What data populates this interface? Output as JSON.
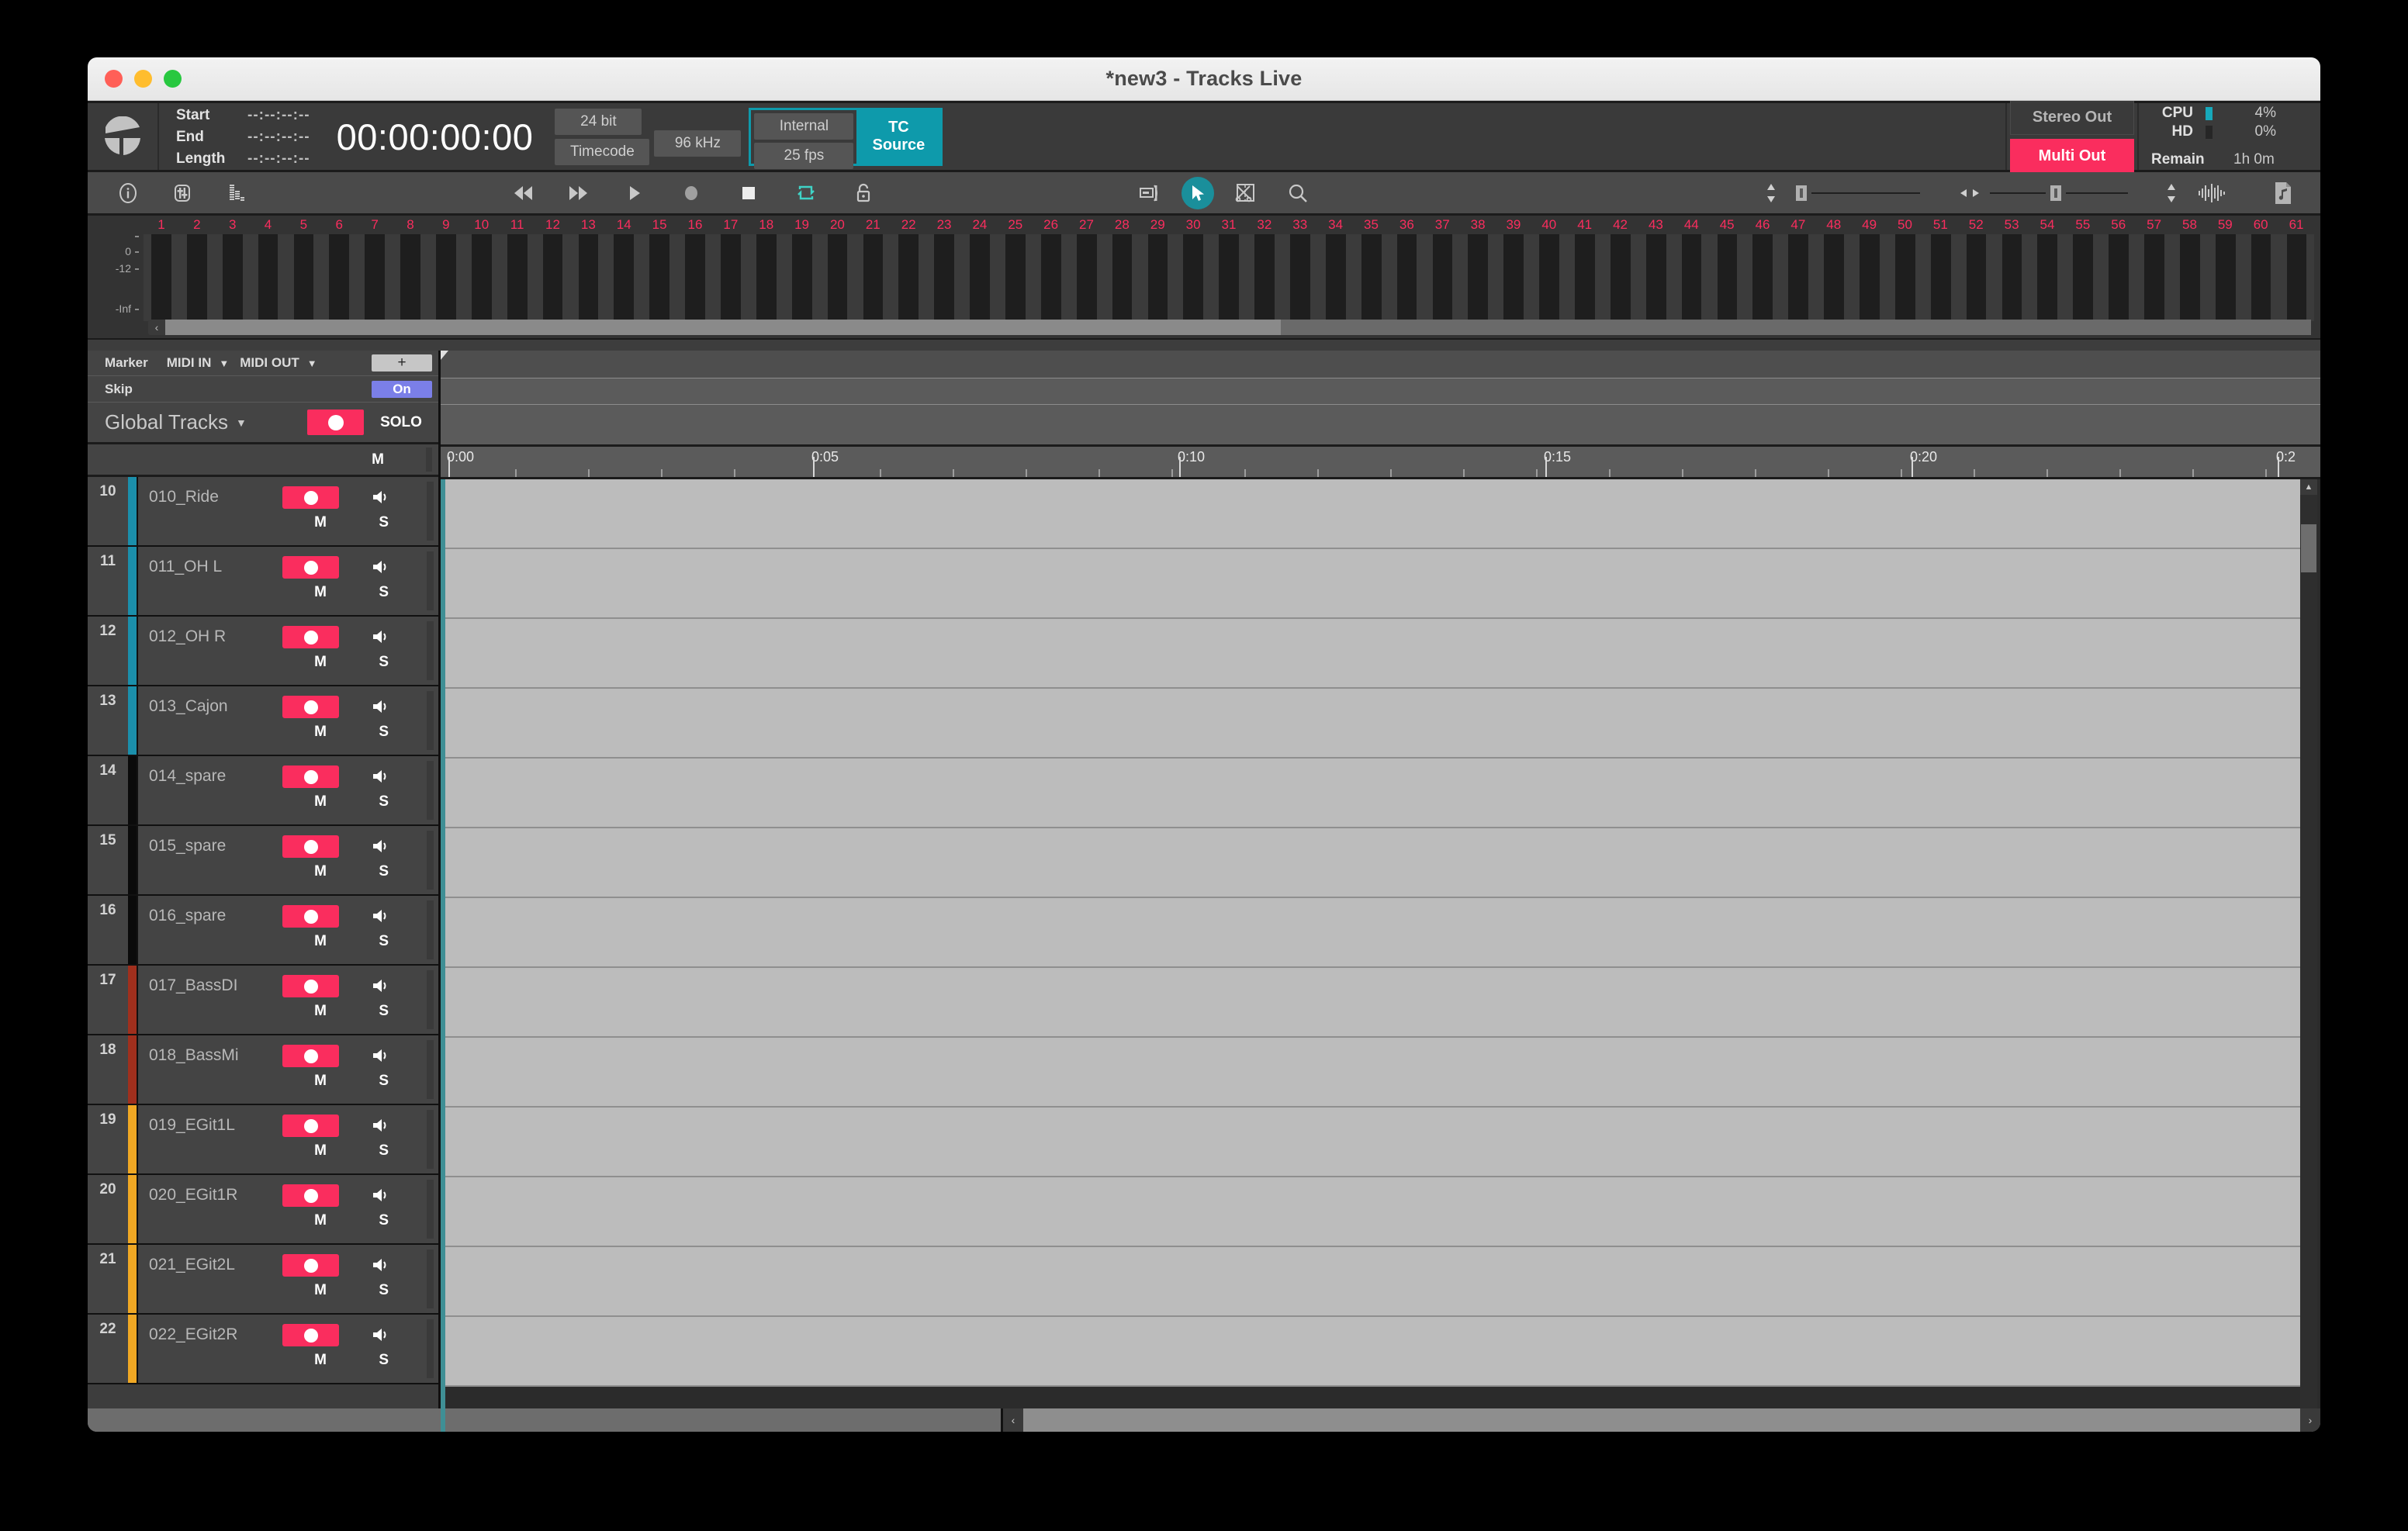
{
  "window": {
    "title": "*new3 - Tracks Live",
    "traffic_lights": [
      "close",
      "minimize",
      "zoom"
    ]
  },
  "infobar": {
    "logo": "tracks-live-logo",
    "selection": [
      {
        "label": "Start",
        "value": "--:--:--:--"
      },
      {
        "label": "End",
        "value": "--:--:--:--"
      },
      {
        "label": "Length",
        "value": "--:--:--:--"
      }
    ],
    "main_timecode": "00:00:00:00",
    "bit_depth": "24 bit",
    "timecode_button": "Timecode",
    "sample_rate": "96 kHz",
    "clock_source": "Internal",
    "frame_rate": "25 fps",
    "tc_source_label": "TC\nSource",
    "tc_source_line1": "TC",
    "tc_source_line2": "Source",
    "outputs": {
      "stereo": "Stereo Out",
      "multi": "Multi Out"
    },
    "stats": {
      "cpu_label": "CPU",
      "cpu_value": "4%",
      "hd_label": "HD",
      "hd_value": "0%",
      "remain_label": "Remain",
      "remain_value": "1h 0m"
    },
    "colors": {
      "accent_teal": "#0e9aab",
      "accent_pink": "#fa2d5e"
    }
  },
  "toolbar": {
    "items": [
      {
        "name": "info-icon",
        "title": "Info"
      },
      {
        "name": "mixer-icon",
        "title": "Mixer"
      },
      {
        "name": "meters-icon",
        "title": "Meters"
      },
      {
        "name": "rewind-icon",
        "title": "Rewind"
      },
      {
        "name": "fast-forward-icon",
        "title": "Fast Forward"
      },
      {
        "name": "play-icon",
        "title": "Play"
      },
      {
        "name": "record-icon",
        "title": "Record"
      },
      {
        "name": "stop-icon",
        "title": "Stop"
      },
      {
        "name": "loop-icon",
        "title": "Loop"
      },
      {
        "name": "lock-icon",
        "title": "Lock"
      },
      {
        "name": "grabber-icon",
        "title": "Grabber"
      },
      {
        "name": "pointer-icon",
        "title": "Selector",
        "selected": true
      },
      {
        "name": "trim-icon",
        "title": "Trim"
      },
      {
        "name": "zoom-icon",
        "title": "Zoom"
      },
      {
        "name": "track-height-icon",
        "title": "Track Height"
      },
      {
        "name": "h-zoom-icon",
        "title": "Horizontal Zoom"
      },
      {
        "name": "waveform-zoom-icon",
        "title": "Waveform Zoom"
      },
      {
        "name": "audio-file-icon",
        "title": "Audio Files"
      }
    ]
  },
  "meterbar": {
    "channel_count": 61,
    "channel_numbers": [
      1,
      2,
      3,
      4,
      5,
      6,
      7,
      8,
      9,
      10,
      11,
      12,
      13,
      14,
      15,
      16,
      17,
      18,
      19,
      20,
      21,
      22,
      23,
      24,
      25,
      26,
      27,
      28,
      29,
      30,
      31,
      32,
      33,
      34,
      35,
      36,
      37,
      38,
      39,
      40,
      41,
      42,
      43,
      44,
      45,
      46,
      47,
      48,
      49,
      50,
      51,
      52,
      53,
      54,
      55,
      56,
      57,
      58,
      59,
      60,
      61
    ],
    "db_labels": [
      "0",
      "-12",
      "-Inf"
    ],
    "number_color": "#fa2d5e"
  },
  "left_header": {
    "marker": "Marker",
    "midi_in": "MIDI IN",
    "midi_out": "MIDI OUT",
    "add_button": "+",
    "skip": "Skip",
    "skip_state": "On",
    "global_tracks": "Global Tracks",
    "solo": "SOLO",
    "master_m": "M"
  },
  "ruler": {
    "labels": [
      "0:00",
      "0:05",
      "0:10",
      "0:15",
      "0:20",
      "0:2"
    ],
    "label_x": [
      8,
      478,
      950,
      1422,
      1894,
      2366
    ]
  },
  "tracks": [
    {
      "num": "10",
      "name": "010_Ride",
      "color": "#1b8fab",
      "rec": true,
      "m": "M",
      "s": "S"
    },
    {
      "num": "11",
      "name": "011_OH L",
      "color": "#1b8fab",
      "rec": true,
      "m": "M",
      "s": "S"
    },
    {
      "num": "12",
      "name": "012_OH R",
      "color": "#1b8fab",
      "rec": true,
      "m": "M",
      "s": "S"
    },
    {
      "num": "13",
      "name": "013_Cajon",
      "color": "#1b8fab",
      "rec": true,
      "m": "M",
      "s": "S"
    },
    {
      "num": "14",
      "name": "014_spare",
      "color": "#0a0a0a",
      "rec": true,
      "m": "M",
      "s": "S"
    },
    {
      "num": "15",
      "name": "015_spare",
      "color": "#0a0a0a",
      "rec": true,
      "m": "M",
      "s": "S"
    },
    {
      "num": "16",
      "name": "016_spare",
      "color": "#0a0a0a",
      "rec": true,
      "m": "M",
      "s": "S"
    },
    {
      "num": "17",
      "name": "017_BassDI",
      "color": "#a02f1d",
      "rec": true,
      "m": "M",
      "s": "S"
    },
    {
      "num": "18",
      "name": "018_BassMi",
      "color": "#a02f1d",
      "rec": true,
      "m": "M",
      "s": "S"
    },
    {
      "num": "19",
      "name": "019_EGit1L",
      "color": "#f0a824",
      "rec": true,
      "m": "M",
      "s": "S"
    },
    {
      "num": "20",
      "name": "020_EGit1R",
      "color": "#f0a824",
      "rec": true,
      "m": "M",
      "s": "S"
    },
    {
      "num": "21",
      "name": "021_EGit2L",
      "color": "#f0a824",
      "rec": true,
      "m": "M",
      "s": "S"
    },
    {
      "num": "22",
      "name": "022_EGit2R",
      "color": "#f0a824",
      "rec": true,
      "m": "M",
      "s": "S"
    }
  ],
  "scrollbars": {
    "v_up": "▲",
    "v_down": "▼",
    "h_left": "‹",
    "h_right": "›"
  }
}
